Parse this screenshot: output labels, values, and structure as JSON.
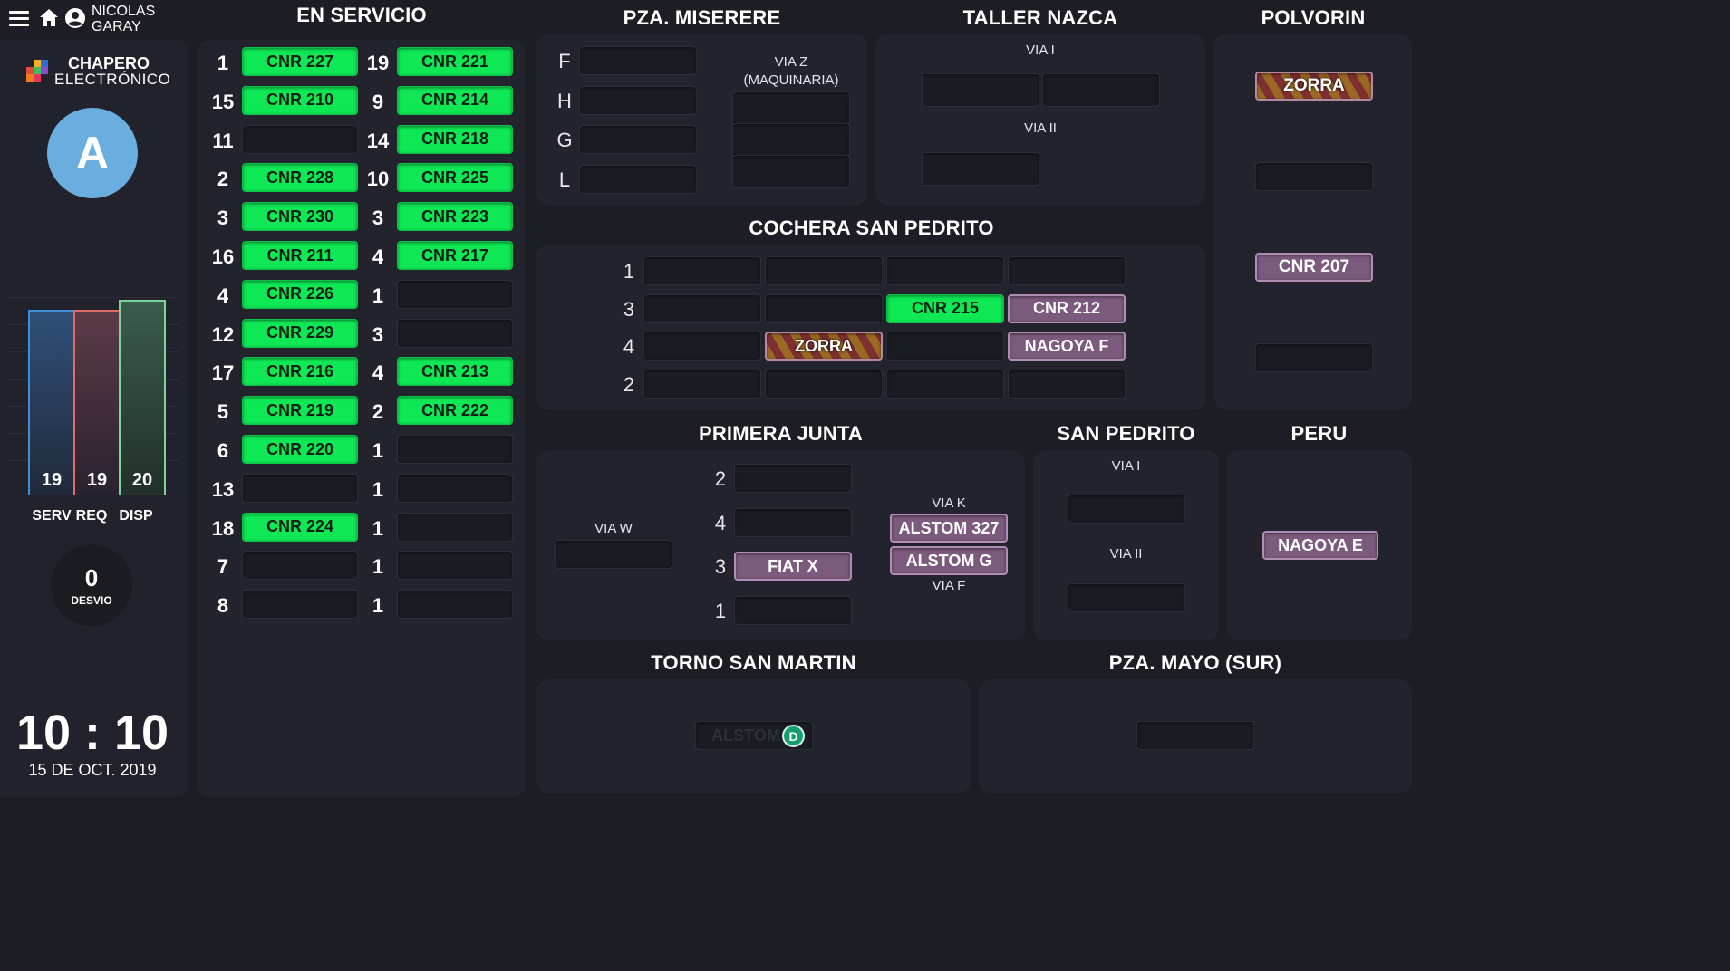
{
  "header": {
    "user_name": "NICOLAS\nGARAY",
    "menu_icon": "menu-icon",
    "home_icon": "home-icon",
    "user_icon": "account-icon"
  },
  "brand": {
    "line1": "CHAPERO",
    "line2": "ELECTRÓNICO"
  },
  "avatar": {
    "letter": "A",
    "color": "#6aaee0"
  },
  "stats": {
    "serv": {
      "value": "19",
      "label": "SERV",
      "color": "#3c8fd8"
    },
    "req": {
      "value": "19",
      "label": "REQ",
      "color": "#e06b6b"
    },
    "disp": {
      "value": "20",
      "label": "DISP",
      "color": "#7ed39a"
    }
  },
  "desvio": {
    "value": "0",
    "label": "DESVIO"
  },
  "clock": {
    "time": "10 : 10",
    "date": "15 DE OCT. 2019"
  },
  "en_servicio": {
    "title": "EN SERVICIO",
    "left": [
      {
        "num": "1",
        "unit": "CNR 227"
      },
      {
        "num": "15",
        "unit": "CNR 210"
      },
      {
        "num": "11",
        "unit": ""
      },
      {
        "num": "2",
        "unit": "CNR 228"
      },
      {
        "num": "3",
        "unit": "CNR 230"
      },
      {
        "num": "16",
        "unit": "CNR 211"
      },
      {
        "num": "4",
        "unit": "CNR 226"
      },
      {
        "num": "12",
        "unit": "CNR 229"
      },
      {
        "num": "17",
        "unit": "CNR 216"
      },
      {
        "num": "5",
        "unit": "CNR 219"
      },
      {
        "num": "6",
        "unit": "CNR 220"
      },
      {
        "num": "13",
        "unit": ""
      },
      {
        "num": "18",
        "unit": "CNR 224"
      },
      {
        "num": "7",
        "unit": ""
      },
      {
        "num": "8",
        "unit": ""
      }
    ],
    "right": [
      {
        "num": "19",
        "unit": "CNR 221"
      },
      {
        "num": "9",
        "unit": "CNR 214"
      },
      {
        "num": "14",
        "unit": "CNR 218"
      },
      {
        "num": "10",
        "unit": "CNR 225"
      },
      {
        "num": "3",
        "unit": "CNR 223"
      },
      {
        "num": "4",
        "unit": "CNR 217"
      },
      {
        "num": "1",
        "unit": ""
      },
      {
        "num": "3",
        "unit": ""
      },
      {
        "num": "4",
        "unit": "CNR 213"
      },
      {
        "num": "2",
        "unit": "CNR 222"
      },
      {
        "num": "1",
        "unit": ""
      },
      {
        "num": "1",
        "unit": ""
      },
      {
        "num": "1",
        "unit": ""
      },
      {
        "num": "1",
        "unit": ""
      },
      {
        "num": "1",
        "unit": ""
      }
    ]
  },
  "miserere": {
    "title": "PZA. MISERERE",
    "rows": [
      "F",
      "H",
      "G",
      "L"
    ],
    "via_z": "VIA Z\n(MAQUINARIA)"
  },
  "nazca": {
    "title": "TALLER NAZCA",
    "via1": "VIA I",
    "via2": "VIA II"
  },
  "polvorin": {
    "title": "POLVORIN",
    "slot1": "ZORRA",
    "slot3": "CNR 207"
  },
  "san_pedrito_cochera": {
    "title": "COCHERA SAN PEDRITO",
    "rows": [
      {
        "label": "1",
        "slots": [
          "",
          "",
          "",
          ""
        ]
      },
      {
        "label": "3",
        "slots": [
          "",
          "",
          "CNR 215",
          "CNR 212"
        ]
      },
      {
        "label": "4",
        "slots": [
          "",
          "ZORRA",
          "",
          "NAGOYA F"
        ]
      },
      {
        "label": "2",
        "slots": [
          "",
          "",
          "",
          ""
        ]
      }
    ]
  },
  "primera_junta": {
    "title": "PRIMERA JUNTA",
    "via_w": "VIA W",
    "rows": [
      {
        "label": "2",
        "unit": ""
      },
      {
        "label": "4",
        "unit": ""
      },
      {
        "label": "3",
        "unit": "FIAT X"
      },
      {
        "label": "1",
        "unit": ""
      }
    ],
    "via_k": "VIA K",
    "via_f": "VIA F",
    "k_unit": "ALSTOM 327",
    "f_unit": "ALSTOM G"
  },
  "san_pedrito": {
    "title": "SAN PEDRITO",
    "via1": "VIA I",
    "via2": "VIA II"
  },
  "peru": {
    "title": "PERU",
    "unit": "NAGOYA E"
  },
  "torno": {
    "title": "TORNO SAN MARTIN",
    "unit": "ALSTOM C",
    "badge": "D"
  },
  "mayo": {
    "title": "PZA. MAYO (SUR)"
  }
}
